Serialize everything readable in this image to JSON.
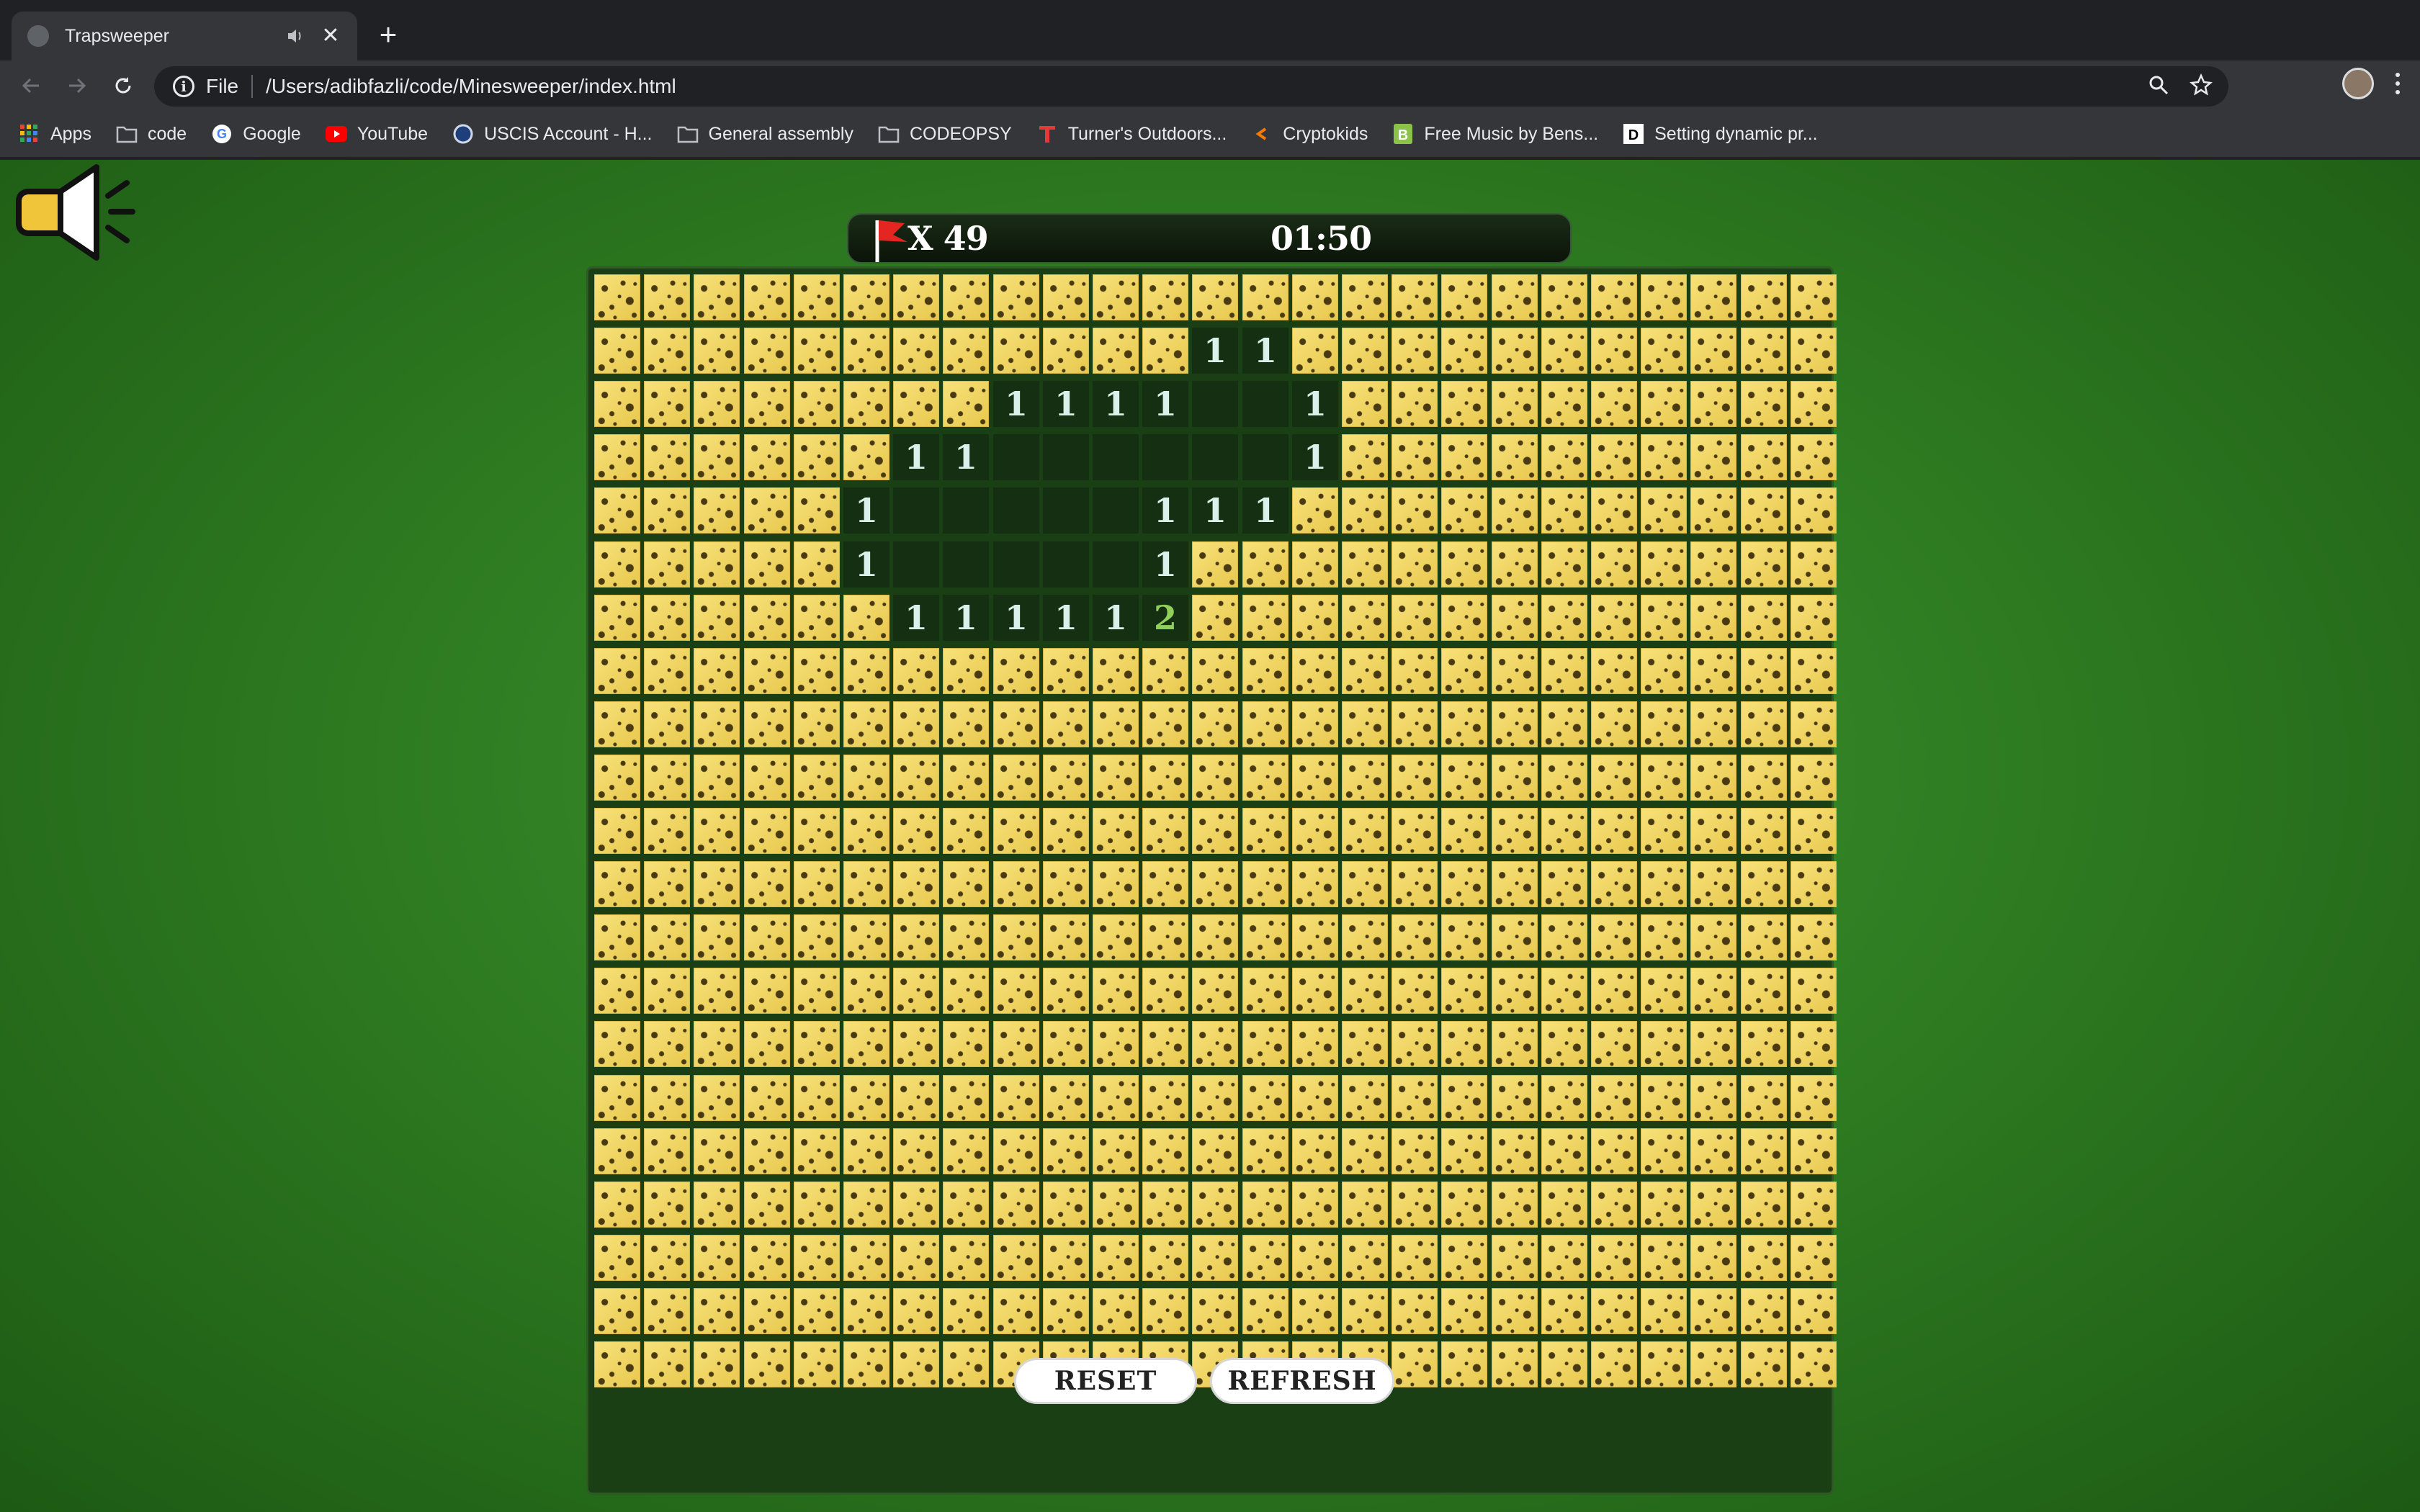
{
  "browser": {
    "tab": {
      "title": "Trapsweeper"
    },
    "new_tab_symbol": "+",
    "close_symbol": "✕",
    "address": {
      "scheme": "File",
      "url": "/Users/adibfazli/code/Minesweeper/index.html"
    },
    "bookmarks": [
      {
        "label": "Apps",
        "icon": "apps-grid-icon"
      },
      {
        "label": "code",
        "icon": "folder-icon"
      },
      {
        "label": "Google",
        "icon": "google-icon"
      },
      {
        "label": "YouTube",
        "icon": "youtube-icon"
      },
      {
        "label": "USCIS Account - H...",
        "icon": "uscis-seal-icon"
      },
      {
        "label": "General assembly",
        "icon": "folder-icon"
      },
      {
        "label": "CODEOPSY",
        "icon": "folder-icon"
      },
      {
        "label": "Turner's Outdoors...",
        "icon": "turners-icon"
      },
      {
        "label": "Cryptokids",
        "icon": "cryptokids-icon"
      },
      {
        "label": "Free Music by Bens...",
        "icon": "bensound-icon"
      },
      {
        "label": "Setting dynamic pr...",
        "icon": "d-icon"
      }
    ]
  },
  "game": {
    "sound_icon": "speaker-on-icon",
    "flag_icon": "red-flag-icon",
    "flag_count": "X 49",
    "timer": "01:50",
    "columns": 25,
    "rows": 21,
    "revealed": [
      {
        "row": 1,
        "col": 12,
        "value": "1"
      },
      {
        "row": 1,
        "col": 13,
        "value": "1"
      },
      {
        "row": 2,
        "col": 8,
        "value": "1"
      },
      {
        "row": 2,
        "col": 9,
        "value": "1"
      },
      {
        "row": 2,
        "col": 10,
        "value": "1"
      },
      {
        "row": 2,
        "col": 11,
        "value": "1"
      },
      {
        "row": 2,
        "col": 12,
        "value": ""
      },
      {
        "row": 2,
        "col": 13,
        "value": ""
      },
      {
        "row": 2,
        "col": 14,
        "value": "1"
      },
      {
        "row": 3,
        "col": 6,
        "value": "1"
      },
      {
        "row": 3,
        "col": 7,
        "value": "1"
      },
      {
        "row": 3,
        "col": 8,
        "value": ""
      },
      {
        "row": 3,
        "col": 9,
        "value": ""
      },
      {
        "row": 3,
        "col": 10,
        "value": ""
      },
      {
        "row": 3,
        "col": 11,
        "value": ""
      },
      {
        "row": 3,
        "col": 12,
        "value": ""
      },
      {
        "row": 3,
        "col": 13,
        "value": ""
      },
      {
        "row": 3,
        "col": 14,
        "value": "1"
      },
      {
        "row": 4,
        "col": 5,
        "value": "1"
      },
      {
        "row": 4,
        "col": 6,
        "value": ""
      },
      {
        "row": 4,
        "col": 7,
        "value": ""
      },
      {
        "row": 4,
        "col": 8,
        "value": ""
      },
      {
        "row": 4,
        "col": 9,
        "value": ""
      },
      {
        "row": 4,
        "col": 10,
        "value": ""
      },
      {
        "row": 4,
        "col": 11,
        "value": "1"
      },
      {
        "row": 4,
        "col": 12,
        "value": "1"
      },
      {
        "row": 4,
        "col": 13,
        "value": "1"
      },
      {
        "row": 5,
        "col": 5,
        "value": "1"
      },
      {
        "row": 5,
        "col": 6,
        "value": ""
      },
      {
        "row": 5,
        "col": 7,
        "value": ""
      },
      {
        "row": 5,
        "col": 8,
        "value": ""
      },
      {
        "row": 5,
        "col": 9,
        "value": ""
      },
      {
        "row": 5,
        "col": 10,
        "value": ""
      },
      {
        "row": 5,
        "col": 11,
        "value": "1"
      },
      {
        "row": 6,
        "col": 6,
        "value": "1"
      },
      {
        "row": 6,
        "col": 7,
        "value": "1"
      },
      {
        "row": 6,
        "col": 8,
        "value": "1"
      },
      {
        "row": 6,
        "col": 9,
        "value": "1"
      },
      {
        "row": 6,
        "col": 10,
        "value": "1"
      },
      {
        "row": 6,
        "col": 11,
        "value": "2"
      }
    ],
    "number_colors": {
      "1": "#d9f1ea",
      "2": "#8fcf5a"
    },
    "buttons": {
      "reset": "RESET",
      "refresh": "REFRESH"
    }
  }
}
